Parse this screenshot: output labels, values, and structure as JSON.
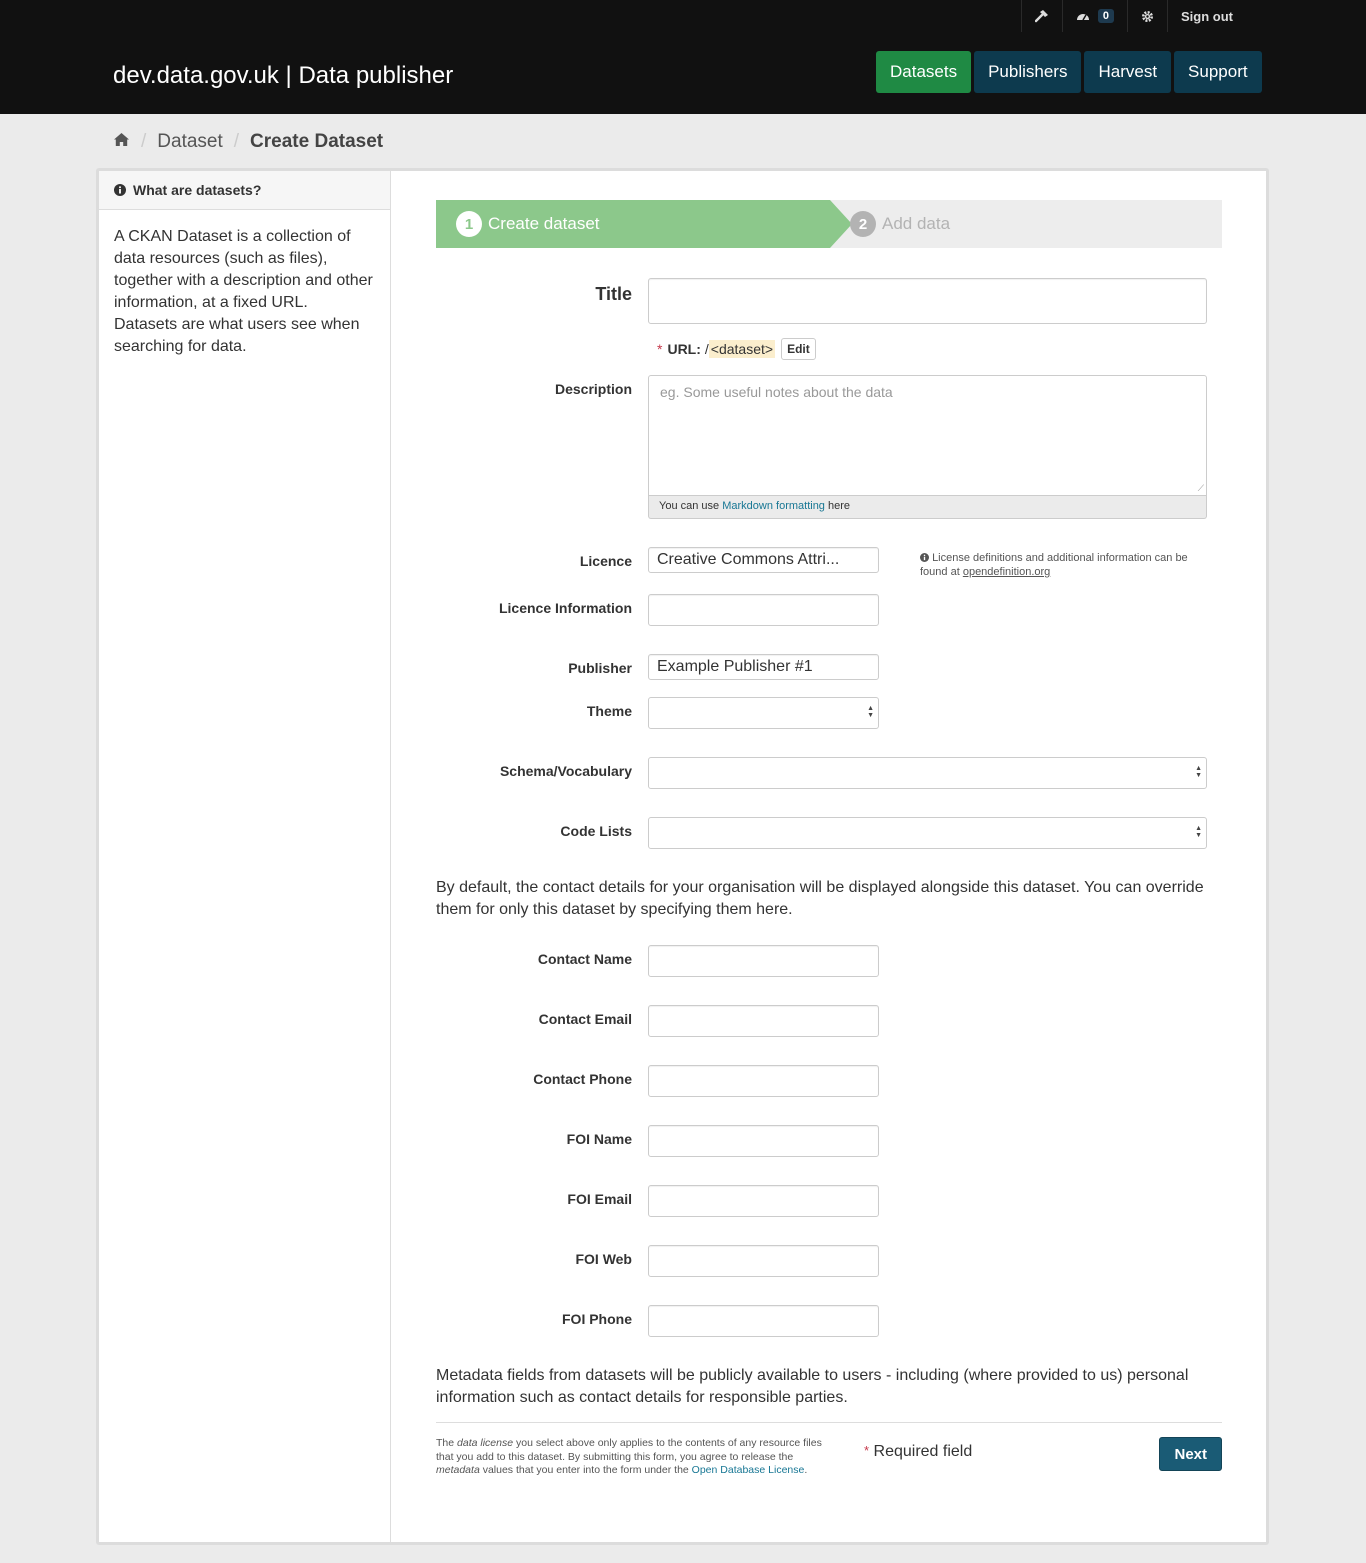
{
  "header": {
    "site_title": "dev.data.gov.uk | Data publisher",
    "account": {
      "dashboard_count": "0",
      "sign_out": "Sign out"
    },
    "nav": [
      {
        "label": "Datasets"
      },
      {
        "label": "Publishers"
      },
      {
        "label": "Harvest"
      },
      {
        "label": "Support"
      }
    ]
  },
  "breadcrumb": {
    "items": [
      "Dataset",
      "Create Dataset"
    ]
  },
  "sidebar": {
    "heading": "What are datasets?",
    "body": "A CKAN Dataset is a collection of data resources (such as files), together with a description and other information, at a fixed URL. Datasets are what users see when searching for data."
  },
  "stages": {
    "active": {
      "num": "1",
      "label": "Create dataset"
    },
    "next": {
      "num": "2",
      "label": "Add data"
    }
  },
  "form": {
    "title_label": "Title",
    "title_value": "",
    "url_required": "*",
    "url_label": "URL:",
    "url_prefix": "/",
    "url_slug": "<dataset>",
    "url_edit": "Edit",
    "description_label": "Description",
    "description_placeholder": "eg. Some useful notes about the data",
    "markdown_prefix": "You can use",
    "markdown_link": "Markdown formatting",
    "markdown_suffix": "here",
    "licence_label": "Licence",
    "licence_value": "Creative Commons Attri...",
    "licence_hint_text": "License definitions and additional information can be found at",
    "licence_hint_link": "opendefinition.org",
    "licence_info_label": "Licence Information",
    "publisher_label": "Publisher",
    "publisher_value": "Example Publisher #1",
    "theme_label": "Theme",
    "schema_label": "Schema/Vocabulary",
    "codelists_label": "Code Lists",
    "contact_intro": "By default, the contact details for your organisation will be displayed alongside this dataset. You can override them for only this dataset by specifying them here.",
    "contact_name_label": "Contact Name",
    "contact_email_label": "Contact Email",
    "contact_phone_label": "Contact Phone",
    "foi_name_label": "FOI Name",
    "foi_email_label": "FOI Email",
    "foi_web_label": "FOI Web",
    "foi_phone_label": "FOI Phone",
    "metadata_notice": "Metadata fields from datasets will be publicly available to users - including (where provided to us) personal information such as contact details for responsible parties."
  },
  "footer": {
    "t1": "The",
    "t2": "data license",
    "t3": "you select above only applies to the contents of any resource files that you add to this dataset. By submitting this form, you agree to release the",
    "t4": "metadata",
    "t5": "values that you enter into the form under the",
    "link": "Open Database License",
    "t6": ".",
    "required_star": "*",
    "required_text": "Required field",
    "next_label": "Next"
  },
  "colors": {
    "masthead": "#111111",
    "nav_active": "#1f8a44",
    "nav_default": "#0d3a4e",
    "stage_active": "#8cc88b",
    "next_button": "#1a5b75",
    "required": "#c6384b"
  },
  "icons": [
    "hammer-icon",
    "dashboard-icon",
    "gear-icon",
    "home-icon",
    "info-icon"
  ]
}
